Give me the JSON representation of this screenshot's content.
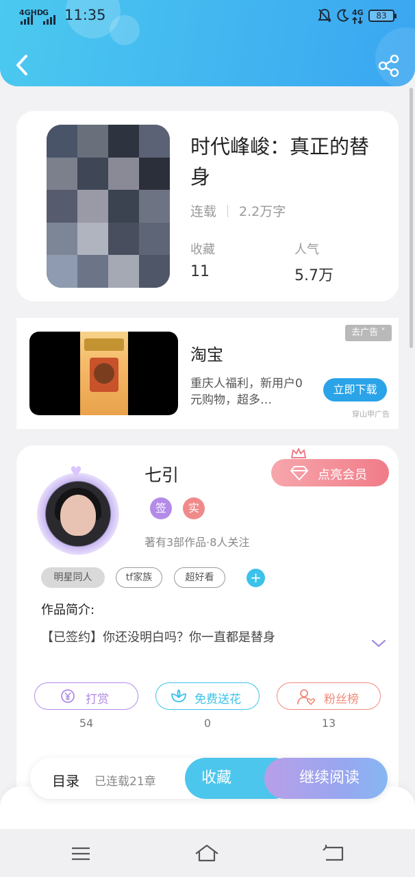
{
  "status_bar": {
    "network_1": "4GHD",
    "network_2": "G",
    "time": "11:35",
    "network_3": "4G",
    "battery": "83"
  },
  "header": {
    "back_icon": "chevron-left-icon",
    "share_icon": "share-icon",
    "color_start": "#4bc9ef",
    "color_end": "#3aa6f1"
  },
  "book": {
    "title": "时代峰峻：真正的替身",
    "status": "连载",
    "word_count": "2.2万字",
    "stats": [
      {
        "label": "收藏",
        "value": "11"
      },
      {
        "label": "人气",
        "value": "5.7万"
      }
    ]
  },
  "ad": {
    "close_label": "去广告 ˅",
    "title": "淘宝",
    "description": "重庆人福利，新用户0元购物，超多…",
    "cta": "立即下载",
    "source": "穿山甲广告"
  },
  "author": {
    "name": "七引",
    "vip_label": "点亮会员",
    "badges": [
      {
        "label": "签",
        "color": "#b48be8"
      },
      {
        "label": "实",
        "color": "#f08a8a"
      }
    ],
    "info": "著有3部作品·8人关注",
    "tags": [
      "明星同人",
      "tf家族",
      "超好看"
    ],
    "add_tag": "+"
  },
  "intro": {
    "label": "作品简介:",
    "text": "【已签约】你还没明白吗？你一直都是替身"
  },
  "actions": [
    {
      "label": "打赏",
      "count": "54",
      "color": "#b18be6",
      "icon": "yen-coin-icon"
    },
    {
      "label": "免费送花",
      "count": "0",
      "color": "#3cc2ea",
      "icon": "flower-icon"
    },
    {
      "label": "粉丝榜",
      "count": "13",
      "color": "#f08a7a",
      "icon": "fan-ranking-icon"
    }
  ],
  "bottom_bar": {
    "toc_label": "目录",
    "chapter_count": "已连载21章",
    "fav_label": "收藏",
    "read_label": "继续阅读"
  },
  "system_nav": {
    "menu_icon": "menu-icon",
    "home_icon": "home-icon",
    "back_icon": "return-icon"
  }
}
